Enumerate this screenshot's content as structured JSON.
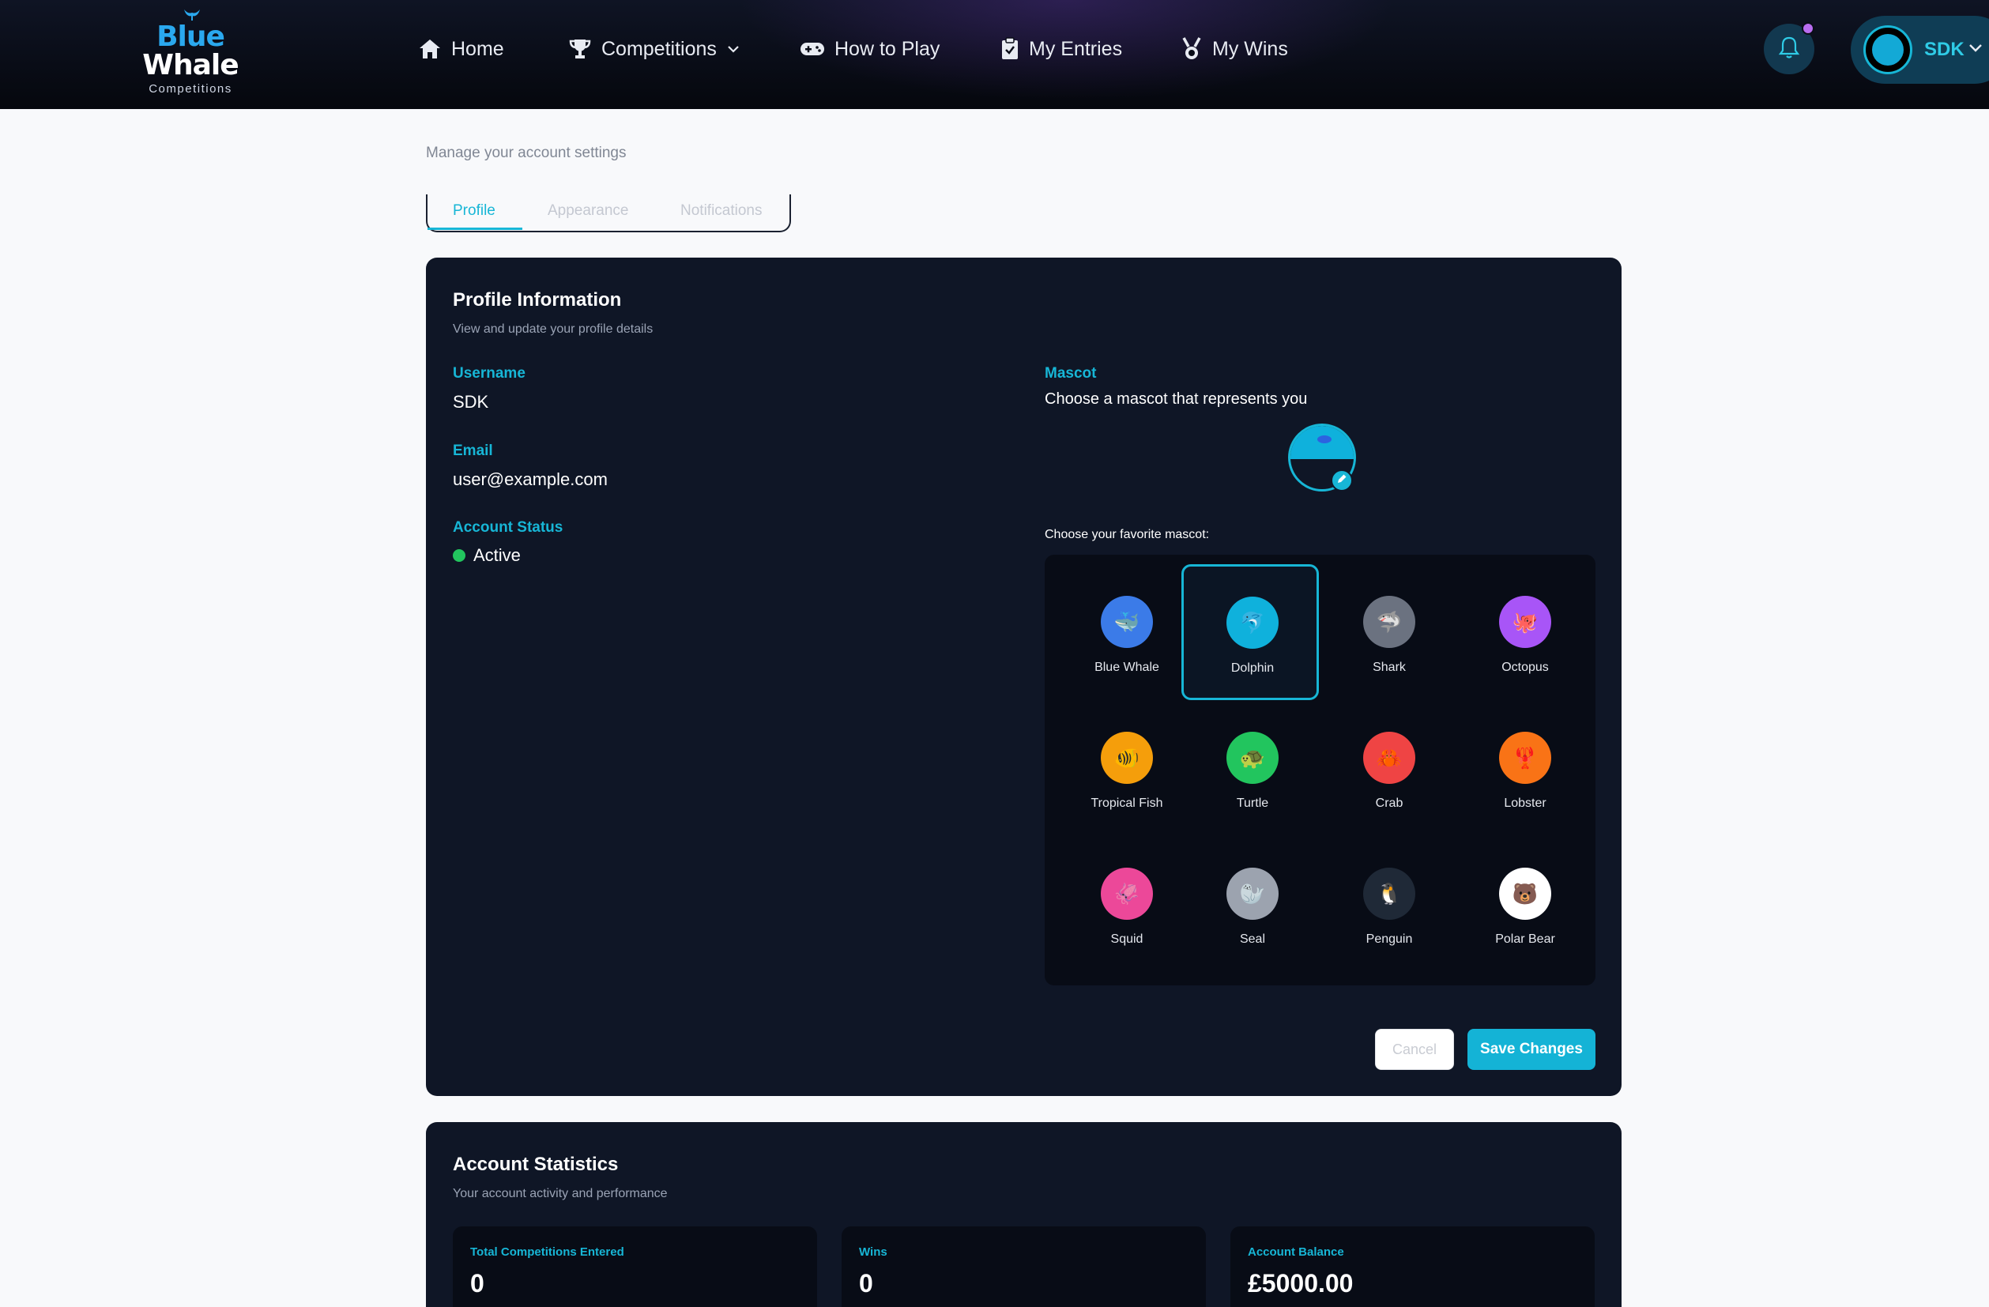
{
  "brand": {
    "line1": "Blue",
    "line2": "Whale",
    "line3": "Competitions",
    "accent": "#17b6d6"
  },
  "nav": {
    "items": [
      {
        "label": "Home",
        "icon": "home-icon"
      },
      {
        "label": "Competitions",
        "icon": "trophy-icon",
        "has_dropdown": true
      },
      {
        "label": "How to Play",
        "icon": "gamepad-icon"
      },
      {
        "label": "My Entries",
        "icon": "clipboard-icon"
      },
      {
        "label": "My Wins",
        "icon": "medal-icon"
      }
    ],
    "notifications_icon": "bell-icon",
    "user_name": "SDK"
  },
  "page": {
    "subtitle": "Manage your account settings",
    "tabs": [
      "Profile",
      "Appearance",
      "Notifications"
    ],
    "active_tab": "Profile"
  },
  "profile": {
    "title": "Profile Information",
    "subtitle": "View and update your profile details",
    "username_label": "Username",
    "username": "SDK",
    "email_label": "Email",
    "email": "user@example.com",
    "status_label": "Account Status",
    "status": "Active",
    "mascot_label": "Mascot",
    "mascot_desc": "Choose a mascot that represents you",
    "choose_label": "Choose your favorite mascot:",
    "selected_mascot": "Dolphin",
    "mascots": [
      {
        "name": "Blue Whale",
        "color": "#3b7be8",
        "emoji": "🐳"
      },
      {
        "name": "Dolphin",
        "color": "#0fb1dc",
        "emoji": "🐬"
      },
      {
        "name": "Shark",
        "color": "#6b7280",
        "emoji": "🦈"
      },
      {
        "name": "Octopus",
        "color": "#a855f7",
        "emoji": "🐙"
      },
      {
        "name": "Tropical Fish",
        "color": "#f59e0b",
        "emoji": "🐠"
      },
      {
        "name": "Turtle",
        "color": "#22c55e",
        "emoji": "🐢"
      },
      {
        "name": "Crab",
        "color": "#ef4444",
        "emoji": "🦀"
      },
      {
        "name": "Lobster",
        "color": "#f97316",
        "emoji": "🦞"
      },
      {
        "name": "Squid",
        "color": "#ec4899",
        "emoji": "🦑"
      },
      {
        "name": "Seal",
        "color": "#9ca3af",
        "emoji": "🦭"
      },
      {
        "name": "Penguin",
        "color": "#1f2937",
        "emoji": "🐧"
      },
      {
        "name": "Polar Bear",
        "color": "#ffffff",
        "emoji": "🐻"
      }
    ],
    "cancel_label": "Cancel",
    "save_label": "Save Changes"
  },
  "stats": {
    "title": "Account Statistics",
    "subtitle": "Your account activity and performance",
    "items": [
      {
        "label": "Total Competitions Entered",
        "value": "0"
      },
      {
        "label": "Wins",
        "value": "0"
      },
      {
        "label": "Account Balance",
        "value": "£5000.00"
      }
    ]
  }
}
